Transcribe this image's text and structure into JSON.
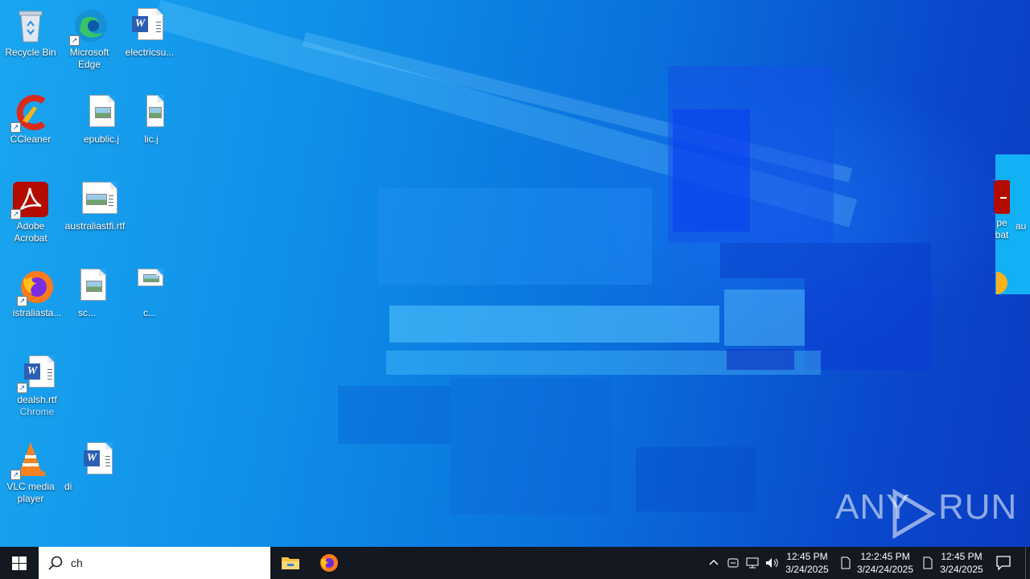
{
  "desktop": {
    "icons": [
      {
        "label": "Recycle Bin",
        "icon": "recycle-bin-icon"
      },
      {
        "label": "Microsoft Edge",
        "icon": "edge-icon"
      },
      {
        "label": "electricsu...",
        "icon": "word-document-icon"
      },
      {
        "label": "CCleaner",
        "icon": "ccleaner-icon"
      },
      {
        "label": "epublic.j",
        "icon": "image-file-icon"
      },
      {
        "label": "lic.j",
        "icon": "image-file-icon"
      },
      {
        "label": "Adobe Acrobat",
        "icon": "adobe-acrobat-icon"
      },
      {
        "label": "australiastfi.rtf",
        "icon": "rtf-document-icon"
      },
      {
        "label": "istraliasta...",
        "icon": "firefox-icon"
      },
      {
        "label": "sc...",
        "icon": "image-file-icon"
      },
      {
        "label": "c...",
        "icon": "image-file-icon"
      },
      {
        "label": "dealsh.rtf",
        "icon": "word-document-icon"
      },
      {
        "label": "Chrome",
        "icon": "chrome-icon"
      },
      {
        "label": "VLC media player",
        "icon": "vlc-icon"
      },
      {
        "label": "di",
        "icon": "word-document-icon"
      },
      {
        "label": "pe",
        "icon": "adobe-acrobat-icon"
      },
      {
        "label": "bat",
        "icon": "adobe-acrobat-icon"
      },
      {
        "label": "au",
        "icon": "document-icon"
      }
    ]
  },
  "watermark": {
    "text_a": "ANY",
    "text_b": "RUN"
  },
  "taskbar": {
    "search_text": "ch",
    "clocks": [
      {
        "time": "12:45 PM",
        "date": "3/24/2025"
      },
      {
        "time": "12:2:45 PM",
        "date": "3/24/24/2025"
      },
      {
        "time": "12:45 PM",
        "date": "3/24/2025"
      }
    ],
    "colors": {
      "taskbar_bg": "#141821",
      "wallpaper_accent": "#0a6fdc"
    }
  }
}
